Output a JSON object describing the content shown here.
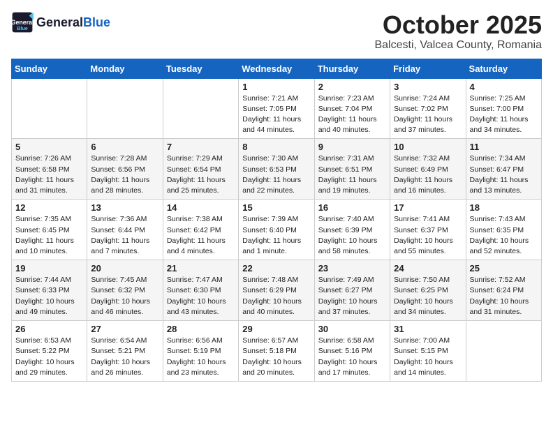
{
  "header": {
    "logo_general": "General",
    "logo_blue": "Blue",
    "month": "October 2025",
    "location": "Balcesti, Valcea County, Romania"
  },
  "weekdays": [
    "Sunday",
    "Monday",
    "Tuesday",
    "Wednesday",
    "Thursday",
    "Friday",
    "Saturday"
  ],
  "weeks": [
    [
      {
        "day": null,
        "info": null
      },
      {
        "day": null,
        "info": null
      },
      {
        "day": null,
        "info": null
      },
      {
        "day": "1",
        "info": "Sunrise: 7:21 AM\nSunset: 7:05 PM\nDaylight: 11 hours and 44 minutes."
      },
      {
        "day": "2",
        "info": "Sunrise: 7:23 AM\nSunset: 7:04 PM\nDaylight: 11 hours and 40 minutes."
      },
      {
        "day": "3",
        "info": "Sunrise: 7:24 AM\nSunset: 7:02 PM\nDaylight: 11 hours and 37 minutes."
      },
      {
        "day": "4",
        "info": "Sunrise: 7:25 AM\nSunset: 7:00 PM\nDaylight: 11 hours and 34 minutes."
      }
    ],
    [
      {
        "day": "5",
        "info": "Sunrise: 7:26 AM\nSunset: 6:58 PM\nDaylight: 11 hours and 31 minutes."
      },
      {
        "day": "6",
        "info": "Sunrise: 7:28 AM\nSunset: 6:56 PM\nDaylight: 11 hours and 28 minutes."
      },
      {
        "day": "7",
        "info": "Sunrise: 7:29 AM\nSunset: 6:54 PM\nDaylight: 11 hours and 25 minutes."
      },
      {
        "day": "8",
        "info": "Sunrise: 7:30 AM\nSunset: 6:53 PM\nDaylight: 11 hours and 22 minutes."
      },
      {
        "day": "9",
        "info": "Sunrise: 7:31 AM\nSunset: 6:51 PM\nDaylight: 11 hours and 19 minutes."
      },
      {
        "day": "10",
        "info": "Sunrise: 7:32 AM\nSunset: 6:49 PM\nDaylight: 11 hours and 16 minutes."
      },
      {
        "day": "11",
        "info": "Sunrise: 7:34 AM\nSunset: 6:47 PM\nDaylight: 11 hours and 13 minutes."
      }
    ],
    [
      {
        "day": "12",
        "info": "Sunrise: 7:35 AM\nSunset: 6:45 PM\nDaylight: 11 hours and 10 minutes."
      },
      {
        "day": "13",
        "info": "Sunrise: 7:36 AM\nSunset: 6:44 PM\nDaylight: 11 hours and 7 minutes."
      },
      {
        "day": "14",
        "info": "Sunrise: 7:38 AM\nSunset: 6:42 PM\nDaylight: 11 hours and 4 minutes."
      },
      {
        "day": "15",
        "info": "Sunrise: 7:39 AM\nSunset: 6:40 PM\nDaylight: 11 hours and 1 minute."
      },
      {
        "day": "16",
        "info": "Sunrise: 7:40 AM\nSunset: 6:39 PM\nDaylight: 10 hours and 58 minutes."
      },
      {
        "day": "17",
        "info": "Sunrise: 7:41 AM\nSunset: 6:37 PM\nDaylight: 10 hours and 55 minutes."
      },
      {
        "day": "18",
        "info": "Sunrise: 7:43 AM\nSunset: 6:35 PM\nDaylight: 10 hours and 52 minutes."
      }
    ],
    [
      {
        "day": "19",
        "info": "Sunrise: 7:44 AM\nSunset: 6:33 PM\nDaylight: 10 hours and 49 minutes."
      },
      {
        "day": "20",
        "info": "Sunrise: 7:45 AM\nSunset: 6:32 PM\nDaylight: 10 hours and 46 minutes."
      },
      {
        "day": "21",
        "info": "Sunrise: 7:47 AM\nSunset: 6:30 PM\nDaylight: 10 hours and 43 minutes."
      },
      {
        "day": "22",
        "info": "Sunrise: 7:48 AM\nSunset: 6:29 PM\nDaylight: 10 hours and 40 minutes."
      },
      {
        "day": "23",
        "info": "Sunrise: 7:49 AM\nSunset: 6:27 PM\nDaylight: 10 hours and 37 minutes."
      },
      {
        "day": "24",
        "info": "Sunrise: 7:50 AM\nSunset: 6:25 PM\nDaylight: 10 hours and 34 minutes."
      },
      {
        "day": "25",
        "info": "Sunrise: 7:52 AM\nSunset: 6:24 PM\nDaylight: 10 hours and 31 minutes."
      }
    ],
    [
      {
        "day": "26",
        "info": "Sunrise: 6:53 AM\nSunset: 5:22 PM\nDaylight: 10 hours and 29 minutes."
      },
      {
        "day": "27",
        "info": "Sunrise: 6:54 AM\nSunset: 5:21 PM\nDaylight: 10 hours and 26 minutes."
      },
      {
        "day": "28",
        "info": "Sunrise: 6:56 AM\nSunset: 5:19 PM\nDaylight: 10 hours and 23 minutes."
      },
      {
        "day": "29",
        "info": "Sunrise: 6:57 AM\nSunset: 5:18 PM\nDaylight: 10 hours and 20 minutes."
      },
      {
        "day": "30",
        "info": "Sunrise: 6:58 AM\nSunset: 5:16 PM\nDaylight: 10 hours and 17 minutes."
      },
      {
        "day": "31",
        "info": "Sunrise: 7:00 AM\nSunset: 5:15 PM\nDaylight: 10 hours and 14 minutes."
      },
      {
        "day": null,
        "info": null
      }
    ]
  ]
}
